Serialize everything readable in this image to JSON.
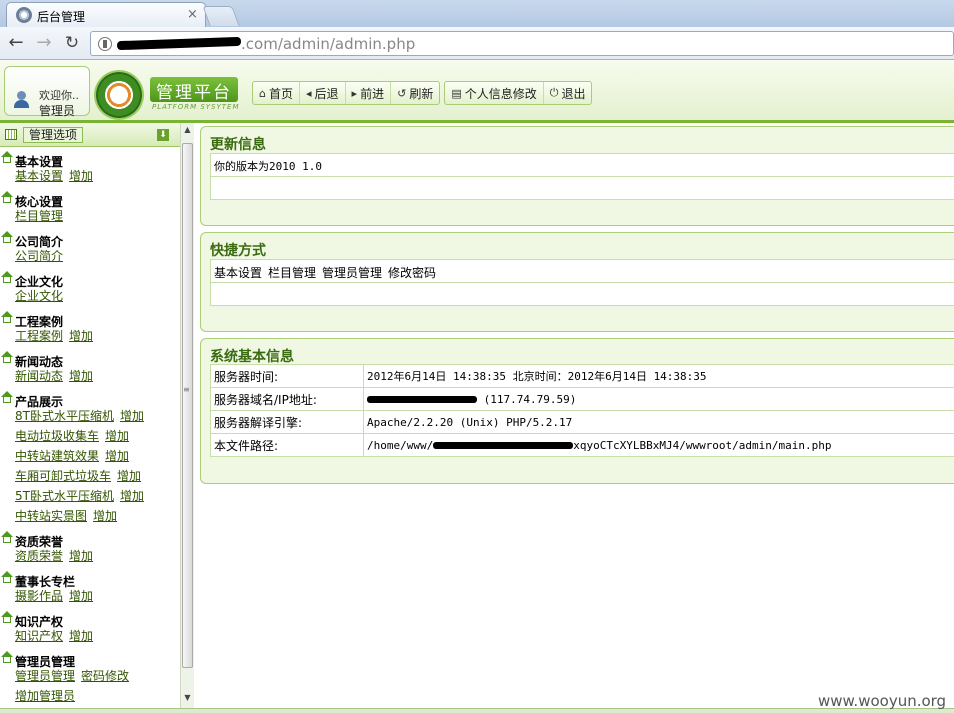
{
  "browser": {
    "tab_title": "后台管理",
    "tab_close": "×",
    "url_visible": "/admin/admin.php",
    "url_host_partial": ".com"
  },
  "header": {
    "welcome": "欢迎你..",
    "role": "管理员",
    "logo_title": "管理平台",
    "logo_subtitle": "PLATFORM SYSYTEM",
    "nav": [
      {
        "label": "首页",
        "icon": "home-icon"
      },
      {
        "label": "后退",
        "icon": "back-arrow-icon"
      },
      {
        "label": "前进",
        "icon": "forward-arrow-icon"
      },
      {
        "label": "刷新",
        "icon": "refresh-icon"
      },
      {
        "label": "个人信息修改",
        "icon": "profile-icon"
      },
      {
        "label": "退出",
        "icon": "power-icon"
      }
    ]
  },
  "sidebar": {
    "title": "管理选项",
    "categories": [
      {
        "name": "基本设置",
        "links": [
          "基本设置",
          "增加"
        ]
      },
      {
        "name": "核心设置",
        "links": [
          "栏目管理"
        ]
      },
      {
        "name": "公司简介",
        "links": [
          "公司简介"
        ]
      },
      {
        "name": "企业文化",
        "links": [
          "企业文化"
        ]
      },
      {
        "name": "工程案例",
        "links": [
          "工程案例",
          "增加"
        ]
      },
      {
        "name": "新闻动态",
        "links": [
          "新闻动态",
          "增加"
        ]
      },
      {
        "name": "产品展示",
        "rows": [
          [
            "8T卧式水平压缩机",
            "增加"
          ],
          [
            "电动垃圾收集车",
            "增加"
          ],
          [
            "中转站建筑效果",
            "增加"
          ],
          [
            "车厢可卸式垃圾车",
            "增加"
          ],
          [
            "5T卧式水平压缩机",
            "增加"
          ],
          [
            "中转站实景图",
            "增加"
          ]
        ]
      },
      {
        "name": "资质荣誉",
        "links": [
          "资质荣誉",
          "增加"
        ]
      },
      {
        "name": "董事长专栏",
        "links": [
          "摄影作品",
          "增加"
        ]
      },
      {
        "name": "知识产权",
        "links": [
          "知识产权",
          "增加"
        ]
      },
      {
        "name": "管理员管理",
        "rows": [
          [
            "管理员管理",
            "密码修改"
          ],
          [
            "增加管理员"
          ]
        ]
      }
    ]
  },
  "panels": {
    "update": {
      "title": "更新信息",
      "text": "你的版本为2010 1.0"
    },
    "shortcuts": {
      "title": "快捷方式",
      "items": [
        "基本设置",
        "栏目管理",
        "管理员管理",
        "修改密码"
      ]
    },
    "sysinfo": {
      "title": "系统基本信息",
      "rows": [
        {
          "key": "服务器时间:",
          "value": "2012年6月14日 14:38:35  北京时间：2012年6月14日 14:38:35"
        },
        {
          "key": "服务器域名/IP地址:",
          "value": " (117.74.79.59)"
        },
        {
          "key": "服务器解译引擎:",
          "value": "Apache/2.2.20 (Unix) PHP/5.2.17"
        },
        {
          "key": "本文件路径:",
          "value_prefix": "/home/www/",
          "value_suffix": "xqyoCTcXYLBBxMJ4/wwwroot/admin/main.php"
        }
      ]
    }
  },
  "watermark": "www.wooyun.org"
}
